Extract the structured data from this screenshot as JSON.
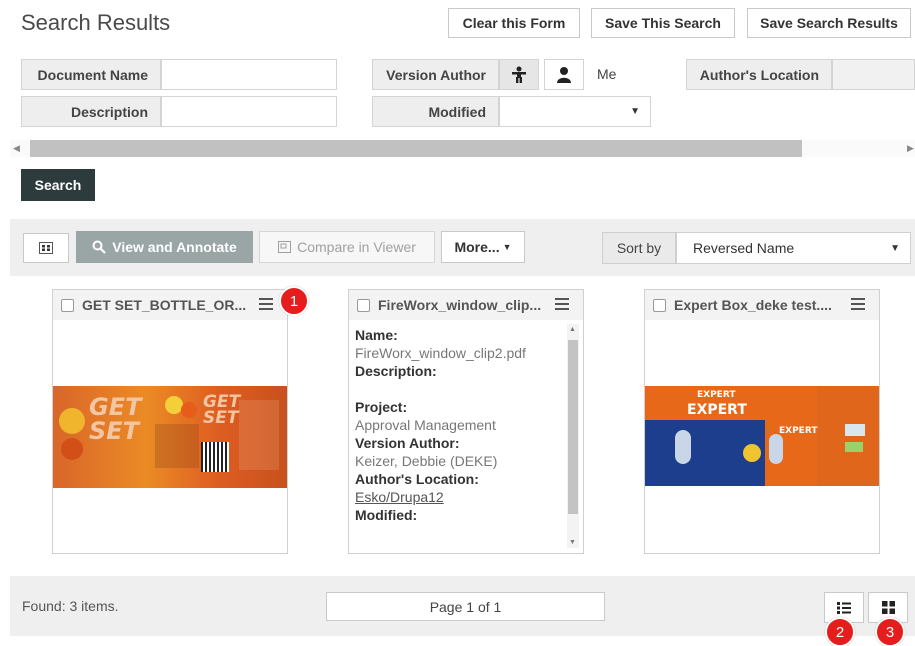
{
  "header": {
    "title": "Search Results"
  },
  "toolbar": {
    "clear_label": "Clear this Form",
    "save_search_label": "Save This Search",
    "save_results_label": "Save Search Results"
  },
  "form": {
    "document_name_label": "Document Name",
    "description_label": "Description",
    "version_author_label": "Version Author",
    "me_label": "Me",
    "modified_label": "Modified",
    "authors_location_label": "Author's Location",
    "search_label": "Search"
  },
  "results_toolbar": {
    "view_annotate_label": "View and Annotate",
    "compare_label": "Compare in Viewer",
    "more_label": "More...",
    "sort_label": "Sort by",
    "sort_value": "Reversed Name"
  },
  "cards": [
    {
      "title": "GET SET_BOTTLE_OR...",
      "badge": "1"
    },
    {
      "title": "FireWorx_window_clip...",
      "name_label": "Name:",
      "name_value": "FireWorx_window_clip2.pdf",
      "description_label": "Description:",
      "project_label": "Project:",
      "project_value": "Approval Management",
      "version_author_label": "Version Author:",
      "version_author_value": "Keizer, Debbie (DEKE)",
      "location_label": "Author's Location:",
      "location_value": "Esko/Drupa12",
      "modified_label": "Modified:"
    },
    {
      "title": "Expert Box_deke test...."
    }
  ],
  "thumbnails": {
    "getset_word1": "GET",
    "getset_word2": "SET",
    "expert_word1": "EXPERT",
    "expert_word2": "EXPERT",
    "expert_word3": "EXPERT"
  },
  "footer": {
    "found_text": "Found: 3 items.",
    "page_text": "Page 1 of 1",
    "badge_list": "2",
    "badge_grid": "3"
  },
  "colors": {
    "search_button": "#2d3b3c",
    "view_button": "#9aa5a6",
    "badge": "#e51d1d",
    "thumb_orange": "#e8681a",
    "thumb_blue": "#1c3e8c"
  }
}
